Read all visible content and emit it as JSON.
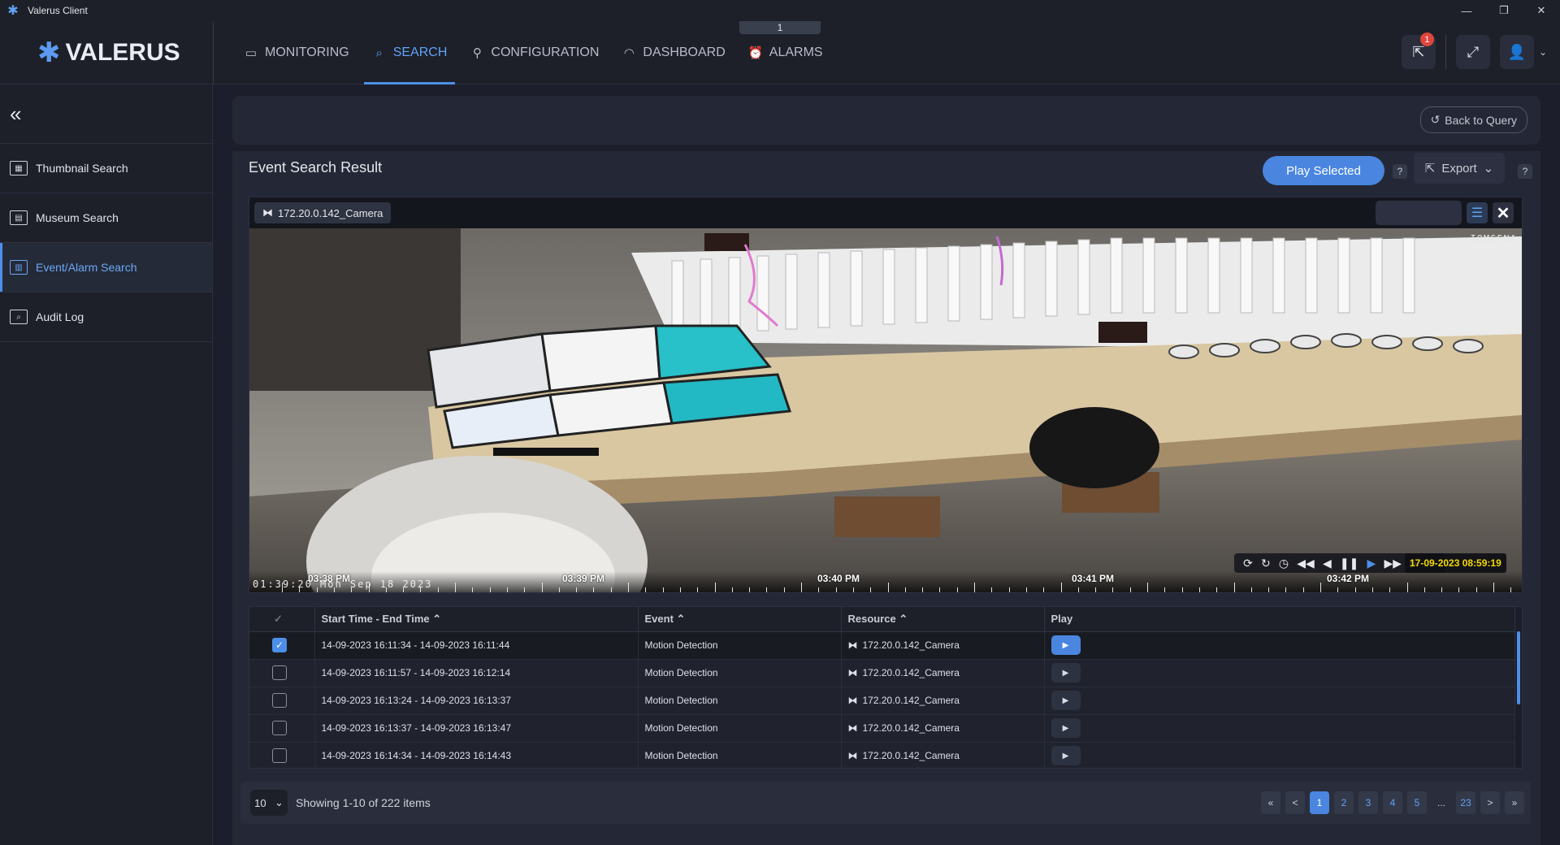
{
  "window": {
    "title": "Valerus Client",
    "controls": [
      "—",
      "❐",
      "✕"
    ]
  },
  "header": {
    "logo": "VALERUS",
    "tabs": [
      {
        "label": "MONITORING",
        "icon": "monitor-icon"
      },
      {
        "label": "SEARCH",
        "icon": "search-icon"
      },
      {
        "label": "CONFIGURATION",
        "icon": "configuration-icon"
      },
      {
        "label": "DASHBOARD",
        "icon": "dashboard-icon"
      },
      {
        "label": "ALARMS",
        "icon": "alarm-icon"
      }
    ],
    "active_tab": "SEARCH",
    "tab_counter": "1",
    "notification_count": "1"
  },
  "sidebar": {
    "items": [
      {
        "label": "Thumbnail Search",
        "icon": "thumbnail-icon"
      },
      {
        "label": "Museum Search",
        "icon": "museum-icon"
      },
      {
        "label": "Event/Alarm Search",
        "icon": "event-alarm-icon"
      },
      {
        "label": "Audit Log",
        "icon": "audit-log-icon"
      }
    ],
    "active_item": "Event/Alarm Search"
  },
  "query": {
    "back_label": "Back to Query"
  },
  "results": {
    "title": "Event Search Result",
    "play_selected": "Play Selected",
    "export_label": "Export",
    "help": "?"
  },
  "player": {
    "camera": "172.20.0.142_Camera",
    "overlay_id": "IQM65NA",
    "osd_time": "01:39:20 Mon Sep 18 2023",
    "timestamp": "17-09-2023 08:59:19",
    "timeline_labels": [
      "03:38 PM",
      "03:39 PM",
      "03:40 PM",
      "03:41 PM",
      "03:42 PM"
    ]
  },
  "table": {
    "columns": [
      "Start Time - End Time",
      "Event",
      "Resource",
      "Play"
    ],
    "rows": [
      {
        "time": "14-09-2023 16:11:34  - 14-09-2023 16:11:44",
        "event": "Motion Detection",
        "resource": "172.20.0.142_Camera",
        "checked": true
      },
      {
        "time": "14-09-2023 16:11:57  - 14-09-2023 16:12:14",
        "event": "Motion Detection",
        "resource": "172.20.0.142_Camera",
        "checked": false
      },
      {
        "time": "14-09-2023 16:13:24  - 14-09-2023 16:13:37",
        "event": "Motion Detection",
        "resource": "172.20.0.142_Camera",
        "checked": false
      },
      {
        "time": "14-09-2023 16:13:37  - 14-09-2023 16:13:47",
        "event": "Motion Detection",
        "resource": "172.20.0.142_Camera",
        "checked": false
      },
      {
        "time": "14-09-2023 16:14:34  - 14-09-2023 16:14:43",
        "event": "Motion Detection",
        "resource": "172.20.0.142_Camera",
        "checked": false
      }
    ]
  },
  "pagination": {
    "page_size": "10",
    "showing": "Showing 1-10 of 222 items",
    "pages": [
      "1",
      "2",
      "3",
      "4",
      "5",
      "...",
      "23"
    ],
    "current": "1",
    "first": "«",
    "prev": "<",
    "next": ">",
    "last": "»"
  },
  "colors": {
    "accent": "#4a86df",
    "timestamp": "#f5d800",
    "badge": "#e0453c"
  }
}
